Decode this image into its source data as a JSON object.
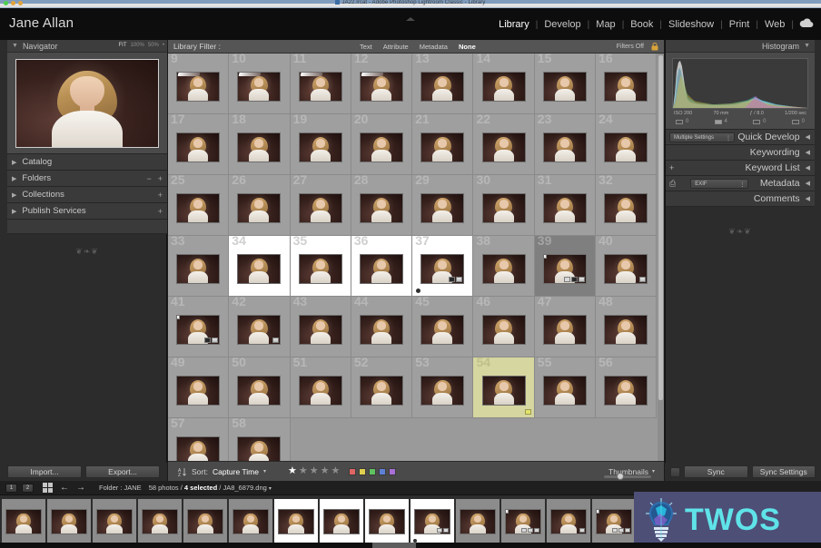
{
  "os": {
    "title": "JA22.lrcat - Adobe Photoshop Lightroom Classic - Library",
    "doc_icon": "document-icon"
  },
  "topbar": {
    "identity": "Jane Allan",
    "modules": [
      {
        "label": "Library",
        "active": true
      },
      {
        "label": "Develop",
        "active": false
      },
      {
        "label": "Map",
        "active": false
      },
      {
        "label": "Book",
        "active": false
      },
      {
        "label": "Slideshow",
        "active": false
      },
      {
        "label": "Print",
        "active": false
      },
      {
        "label": "Web",
        "active": false
      }
    ],
    "separator": "|",
    "cloud_icon": "cloud-sync-icon"
  },
  "left_panel": {
    "navigator": {
      "title": "Navigator",
      "disclosure": "▼",
      "zoom_options": [
        "FIT",
        "100%",
        "50%"
      ],
      "zoom_selected": "FIT",
      "more": "•"
    },
    "sections": [
      {
        "label": "Catalog",
        "tools": []
      },
      {
        "label": "Folders",
        "tools": [
          "−",
          "+"
        ]
      },
      {
        "label": "Collections",
        "tools": [
          "+"
        ]
      },
      {
        "label": "Publish Services",
        "tools": [
          "+"
        ]
      }
    ],
    "import_label": "Import...",
    "export_label": "Export..."
  },
  "right_panel": {
    "histogram": {
      "title": "Histogram",
      "disclosure": "▼",
      "iso": "ISO 200",
      "focal_length": "70 mm",
      "aperture": "ƒ / 8.0",
      "shutter": "1/200 sec",
      "count_unflagged": "0",
      "count_picks": "4",
      "count_rejects": "0",
      "count_other": "0"
    },
    "sections": [
      {
        "label": "Quick Develop",
        "preset_value": "Multiple Settings",
        "has_select": true
      },
      {
        "label": "Keywording",
        "has_select": false
      },
      {
        "label": "Keyword List",
        "plus": "+",
        "has_select": false
      },
      {
        "label": "Metadata",
        "preset_value": "EXIF",
        "has_select": true,
        "tag_icon": "tag-icon"
      },
      {
        "label": "Comments",
        "has_select": false
      }
    ],
    "collapse_arrow": "◀",
    "sync_label": "Sync",
    "sync_settings_label": "Sync Settings"
  },
  "library_filter": {
    "label": "Library Filter :",
    "tabs": [
      {
        "label": "Text",
        "active": false
      },
      {
        "label": "Attribute",
        "active": false
      },
      {
        "label": "Metadata",
        "active": false
      },
      {
        "label": "None",
        "active": true
      }
    ],
    "filters_state": "Filters Off",
    "lock_icon": "lock-icon"
  },
  "grid": {
    "columns": 8,
    "cells": [
      {
        "index": "9",
        "state": "normal",
        "beam": true
      },
      {
        "index": "10",
        "state": "normal",
        "beam": true
      },
      {
        "index": "11",
        "state": "normal",
        "beam": true
      },
      {
        "index": "12",
        "state": "normal",
        "beam": true
      },
      {
        "index": "13",
        "state": "normal",
        "beam": false
      },
      {
        "index": "14",
        "state": "normal",
        "beam": false
      },
      {
        "index": "15",
        "state": "normal",
        "beam": false
      },
      {
        "index": "16",
        "state": "normal",
        "beam": false
      },
      {
        "index": "17",
        "state": "normal",
        "beam": false
      },
      {
        "index": "18",
        "state": "normal",
        "beam": false
      },
      {
        "index": "19",
        "state": "normal",
        "beam": false
      },
      {
        "index": "20",
        "state": "normal",
        "beam": false
      },
      {
        "index": "21",
        "state": "normal",
        "beam": false
      },
      {
        "index": "22",
        "state": "normal",
        "beam": false
      },
      {
        "index": "23",
        "state": "normal",
        "beam": false
      },
      {
        "index": "24",
        "state": "normal",
        "beam": false
      },
      {
        "index": "25",
        "state": "normal",
        "beam": false
      },
      {
        "index": "26",
        "state": "normal",
        "beam": false
      },
      {
        "index": "27",
        "state": "normal",
        "beam": false
      },
      {
        "index": "28",
        "state": "normal",
        "beam": false
      },
      {
        "index": "29",
        "state": "normal",
        "beam": false
      },
      {
        "index": "30",
        "state": "normal",
        "beam": false
      },
      {
        "index": "31",
        "state": "normal",
        "beam": false
      },
      {
        "index": "32",
        "state": "normal",
        "beam": false
      },
      {
        "index": "33",
        "state": "normal",
        "beam": false
      },
      {
        "index": "34",
        "state": "active",
        "beam": false
      },
      {
        "index": "35",
        "state": "active",
        "beam": false
      },
      {
        "index": "36",
        "state": "active",
        "beam": false
      },
      {
        "index": "37",
        "state": "active",
        "beam": false,
        "badges": 2,
        "dot": true
      },
      {
        "index": "38",
        "state": "normal",
        "beam": false
      },
      {
        "index": "39",
        "state": "selected",
        "beam": false,
        "badges": 3,
        "stack": "2"
      },
      {
        "index": "40",
        "state": "normal",
        "beam": false,
        "badges": 1
      },
      {
        "index": "41",
        "state": "normal",
        "beam": false,
        "badges": 2,
        "stack": "2"
      },
      {
        "index": "42",
        "state": "normal",
        "beam": false,
        "badges": 1
      },
      {
        "index": "43",
        "state": "normal",
        "beam": false
      },
      {
        "index": "44",
        "state": "normal",
        "beam": false
      },
      {
        "index": "45",
        "state": "normal",
        "beam": false
      },
      {
        "index": "46",
        "state": "normal",
        "beam": false
      },
      {
        "index": "47",
        "state": "normal",
        "beam": false
      },
      {
        "index": "48",
        "state": "normal",
        "beam": false
      },
      {
        "index": "49",
        "state": "normal",
        "beam": false
      },
      {
        "index": "50",
        "state": "normal",
        "beam": false
      },
      {
        "index": "51",
        "state": "normal",
        "beam": false
      },
      {
        "index": "52",
        "state": "normal",
        "beam": false
      },
      {
        "index": "53",
        "state": "normal",
        "beam": false
      },
      {
        "index": "54",
        "state": "label-yellow",
        "beam": false,
        "chip": true
      },
      {
        "index": "55",
        "state": "normal",
        "beam": false
      },
      {
        "index": "56",
        "state": "normal",
        "beam": false
      },
      {
        "index": "57",
        "state": "normal",
        "beam": false
      },
      {
        "index": "58",
        "state": "normal",
        "beam": false
      }
    ]
  },
  "toolbar": {
    "sort_icon": "sort-az-icon",
    "sort_label": "Sort:",
    "sort_value": "Capture Time",
    "sort_caret": "▾",
    "rating": 1,
    "stars_total": 5,
    "color_swatches": [
      "#e06565",
      "#e0cf4f",
      "#5fc25f",
      "#5f7fd6",
      "#a96fd6"
    ],
    "thumbnails_label": "Thumbnails",
    "thumbnails_caret": "▾"
  },
  "filmstrip": {
    "view_buttons": [
      "1",
      "2"
    ],
    "grid_icon": "grid-view-icon",
    "back_arrow": "←",
    "forward_arrow": "→",
    "folder_label": "Folder : JANE",
    "photo_count": "58 photos /",
    "selected_count": "4 selected",
    "current_file": "/ JA8_6879.dng",
    "caret": "▾",
    "cells": [
      {
        "state": "dim"
      },
      {
        "state": "dim"
      },
      {
        "state": "dim"
      },
      {
        "state": "dim"
      },
      {
        "state": "dim"
      },
      {
        "state": "dim"
      },
      {
        "state": "sel"
      },
      {
        "state": "sel"
      },
      {
        "state": "sel"
      },
      {
        "state": "sel",
        "dot": true
      },
      {
        "state": "dim"
      },
      {
        "state": "dim",
        "badges": 3,
        "stack": "2"
      },
      {
        "state": "dim",
        "badges": 1
      },
      {
        "state": "dim",
        "badges": 3,
        "stack": "2"
      },
      {
        "state": "dim"
      }
    ]
  },
  "watermark": {
    "text": "TWOS",
    "logo_icon": "lightbulb-icon",
    "color": "#5fe3e8",
    "background": "#4d4f77"
  },
  "colors": {
    "app_bg": "#2c2c2c",
    "grid_bg": "#9a9a9a",
    "accent": "#5fe3e8",
    "label_yellow": "#d6d6a0"
  }
}
